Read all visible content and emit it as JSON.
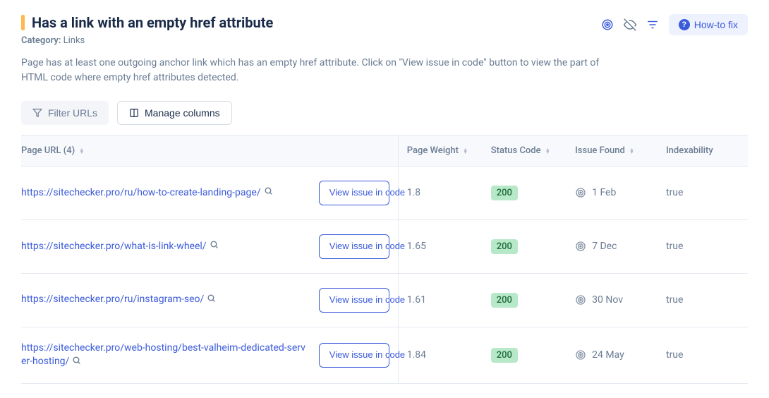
{
  "header": {
    "title": "Has a link with an empty href attribute",
    "category_label": "Category:",
    "category_value": "Links",
    "description": "Page has at least one outgoing anchor link which has an empty href attribute. Click on \"View issue in code\" button to view the part of HTML code where empty href attributes detected.",
    "howto_label": "How-to fix"
  },
  "toolbar": {
    "filter_label": "Filter URLs",
    "columns_label": "Manage columns"
  },
  "table": {
    "headers": {
      "url": "Page URL (4)",
      "weight": "Page Weight",
      "status": "Status Code",
      "issue": "Issue Found",
      "index": "Indexability"
    },
    "view_btn_label": "View issue in code",
    "rows": [
      {
        "url": "https://sitechecker.pro/ru/how-to-create-landing-page/",
        "weight": "1.8",
        "status": "200",
        "issue": "1 Feb",
        "index": "true"
      },
      {
        "url": "https://sitechecker.pro/what-is-link-wheel/",
        "weight": "1.65",
        "status": "200",
        "issue": "7 Dec",
        "index": "true"
      },
      {
        "url": "https://sitechecker.pro/ru/instagram-seo/",
        "weight": "1.61",
        "status": "200",
        "issue": "30 Nov",
        "index": "true"
      },
      {
        "url": "https://sitechecker.pro/web-hosting/best-valheim-dedicated-server-hosting/",
        "weight": "1.84",
        "status": "200",
        "issue": "24 May",
        "index": "true"
      }
    ]
  }
}
